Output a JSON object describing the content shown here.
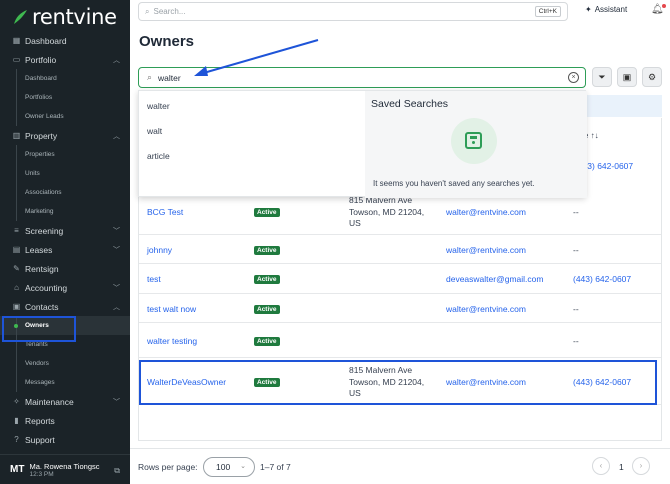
{
  "brand": {
    "name": "rentvine",
    "accent": "#3fb950"
  },
  "sidebar": {
    "items": [
      {
        "label": "Dashboard",
        "icon": "grid-icon"
      },
      {
        "label": "Portfolio",
        "icon": "briefcase-icon",
        "expanded": true
      },
      {
        "label": "Dashboard",
        "sub": true
      },
      {
        "label": "Portfolios",
        "sub": true
      },
      {
        "label": "Owner Leads",
        "sub": true
      },
      {
        "label": "Property",
        "icon": "building-icon",
        "expanded": true
      },
      {
        "label": "Properties",
        "sub": true
      },
      {
        "label": "Units",
        "sub": true
      },
      {
        "label": "Associations",
        "sub": true
      },
      {
        "label": "Marketing",
        "sub": true
      },
      {
        "label": "Screening",
        "icon": "filter-icon",
        "expanded": false
      },
      {
        "label": "Leases",
        "icon": "document-icon",
        "expanded": false
      },
      {
        "label": "Rentsign",
        "icon": "signature-icon"
      },
      {
        "label": "Accounting",
        "icon": "bank-icon",
        "expanded": false
      },
      {
        "label": "Contacts",
        "icon": "contacts-icon",
        "expanded": true
      },
      {
        "label": "Owners",
        "sub": true,
        "active": true
      },
      {
        "label": "Tenants",
        "sub": true
      },
      {
        "label": "Vendors",
        "sub": true
      },
      {
        "label": "Messages",
        "sub": true
      },
      {
        "label": "Maintenance",
        "icon": "wrench-icon",
        "expanded": false
      },
      {
        "label": "Reports",
        "icon": "chart-icon"
      },
      {
        "label": "Support",
        "icon": "help-icon"
      }
    ],
    "user": {
      "initials": "MT",
      "name": "Ma. Rowena Tiongsc",
      "time": "12:3 PM"
    }
  },
  "topbar": {
    "search_placeholder": "Search...",
    "shortcut": "Ctrl+K",
    "assistant_label": "Assistant"
  },
  "page": {
    "title": "Owners"
  },
  "search": {
    "value": "walter"
  },
  "dropdown": {
    "suggestions": [
      "walter",
      "walt",
      "article"
    ],
    "saved_title": "Saved Searches",
    "saved_empty": "It seems you haven't saved any searches yet."
  },
  "table": {
    "phone_header": "one ↑↓",
    "partial_phone": "(443) 642-0607",
    "rows": [
      {
        "name": "BCG Test",
        "status": "Active",
        "address": "Towson, MD 21204,",
        "address2": "US",
        "address_top": "815 Malvern Ave",
        "email": "walter@rentvine.com",
        "phone": "--"
      },
      {
        "name": "johnny",
        "status": "Active",
        "address": "",
        "address2": "",
        "address_top": "",
        "email": "walter@rentvine.com",
        "phone": "--"
      },
      {
        "name": "test",
        "status": "Active",
        "address": "",
        "address2": "",
        "address_top": "",
        "email": "deveaswalter@gmail.com",
        "phone": "(443) 642-0607"
      },
      {
        "name": "test walt now",
        "status": "Active",
        "address": "",
        "address2": "",
        "address_top": "",
        "email": "walter@rentvine.com",
        "phone": "--"
      },
      {
        "name": "walter testing",
        "status": "Active",
        "address": "",
        "address2": "",
        "address_top": "",
        "email": "",
        "phone": "--"
      },
      {
        "name": "WalterDeVeasOwner",
        "status": "Active",
        "address_top": "815 Malvern Ave",
        "address": "Towson, MD 21204,",
        "address2": "US",
        "email": "walter@rentvine.com",
        "phone": "(443) 642-0607"
      }
    ]
  },
  "footer": {
    "rows_label": "Rows per page:",
    "rows_value": "100",
    "range": "1–7 of 7",
    "page": "1"
  }
}
